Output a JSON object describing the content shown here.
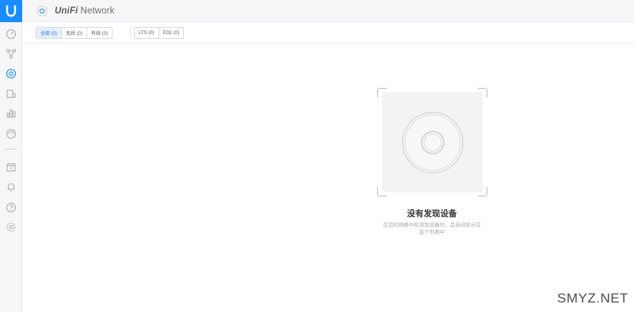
{
  "app": {
    "brand": "UniFi",
    "name": " Network"
  },
  "sidebar": {
    "items": [
      {
        "icon": "dashboard-icon"
      },
      {
        "icon": "topology-icon"
      },
      {
        "icon": "devices-icon"
      },
      {
        "icon": "clients-icon"
      },
      {
        "icon": "statistics-icon"
      },
      {
        "icon": "insights-icon"
      },
      {
        "icon": "events-icon"
      },
      {
        "icon": "alerts-icon"
      },
      {
        "icon": "help-icon"
      },
      {
        "icon": "settings-icon"
      }
    ]
  },
  "filters": {
    "group1": [
      "全部 (0)",
      "无线 (0)",
      "有线 (0)"
    ],
    "group2": [
      "LTS (0)",
      "EOL (0)"
    ],
    "active": "全部 (0)"
  },
  "empty_state": {
    "title": "没有发现设备",
    "description_line1": "在您的网络中检测到设备时，会自动显示在",
    "description_line2": "这个列表中"
  },
  "watermark": "SMYZ.NET",
  "colors": {
    "accent": "#1a8cff",
    "active_filter_bg": "#e6f1ff",
    "active_filter_text": "#1a73e8"
  }
}
